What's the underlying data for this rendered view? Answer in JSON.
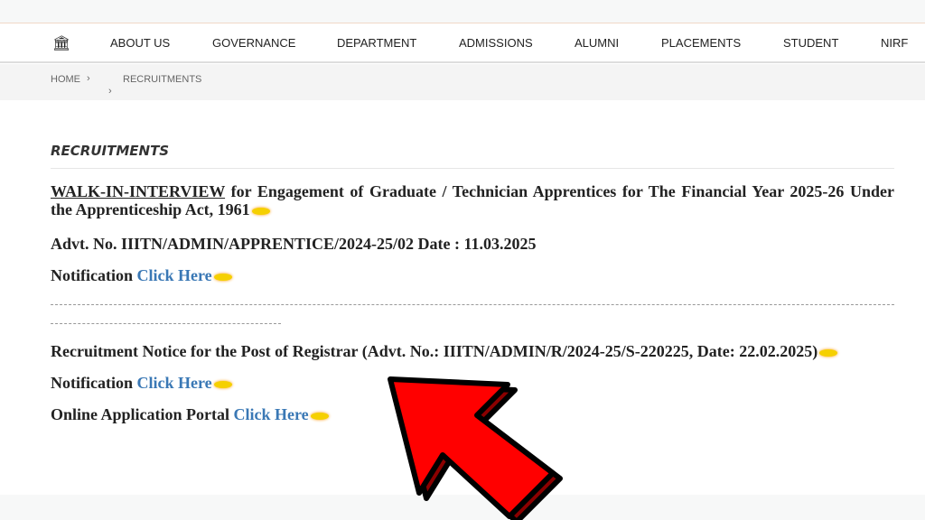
{
  "nav": {
    "items": [
      "ABOUT US",
      "GOVERNANCE",
      "DEPARTMENT",
      "ADMISSIONS",
      "ALUMNI",
      "PLACEMENTS",
      "STUDENT",
      "NIRF"
    ]
  },
  "breadcrumb": {
    "home": "HOME",
    "sep": "›",
    "current": "RECRUITMENTS"
  },
  "page_title": "RECRUITMENTS",
  "item1": {
    "link": "WALK-IN-INTERVIEW",
    "title": " for Engagement of Graduate / Technician Apprentices for The Financial Year 2025-26 Under the Apprenticeship Act, 1961",
    "advt": "Advt. No. IIITN/ADMIN/APPRENTICE/2024-25/02 Date : 11.03.2025",
    "notif_label": "Notification ",
    "click": "Click Here"
  },
  "item2": {
    "title": "Recruitment Notice for the Post of Registrar (Advt. No.: IIITN/ADMIN/R/2024-25/S-220225, Date: 22.02.2025)",
    "notif_label": "Notification ",
    "click": "Click Here",
    "portal_label": "Online Application Portal ",
    "portal_click": "Click Here"
  },
  "colors": {
    "link": "#3a78b5",
    "arrow": "#ff0000"
  }
}
